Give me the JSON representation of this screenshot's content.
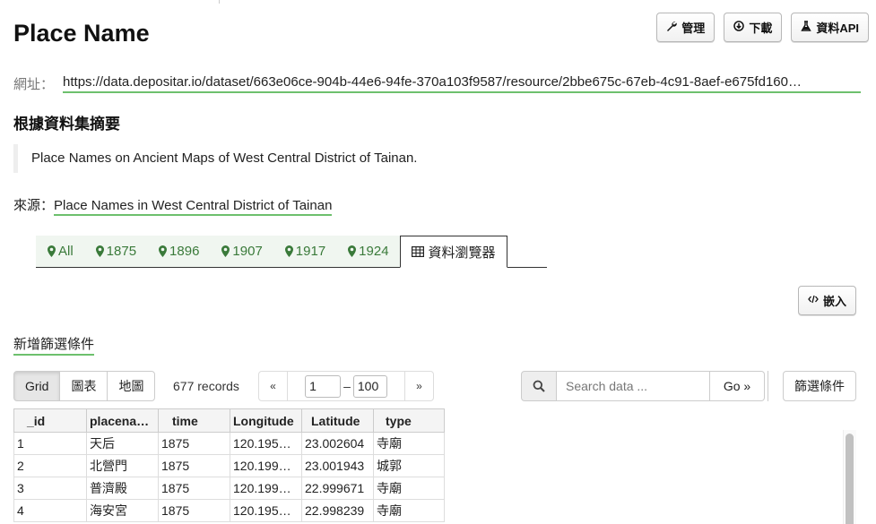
{
  "page": {
    "title": "Place Name"
  },
  "actions": {
    "manage_label": "管理",
    "download_label": "下載",
    "api_label": "資料API"
  },
  "url": {
    "label": "網址：",
    "value": "https://data.depositar.io/dataset/663e06ce-904b-44e6-94fe-370a103f9587/resource/2bbe675c-67eb-4c91-8aef-e675fd160…"
  },
  "summary": {
    "heading": "根據資料集摘要",
    "text": "Place Names on Ancient Maps of West Central District of Tainan."
  },
  "source": {
    "label": "來源：",
    "link_text": "Place Names in West Central District of Tainan"
  },
  "view_tabs": [
    {
      "label": "All",
      "icon": "map-marker-icon"
    },
    {
      "label": "1875",
      "icon": "map-marker-icon"
    },
    {
      "label": "1896",
      "icon": "map-marker-icon"
    },
    {
      "label": "1907",
      "icon": "map-marker-icon"
    },
    {
      "label": "1917",
      "icon": "map-marker-icon"
    },
    {
      "label": "1924",
      "icon": "map-marker-icon"
    },
    {
      "label": "資料瀏覽器",
      "icon": "table-icon",
      "active": true
    }
  ],
  "embed_label": "嵌入",
  "add_filter_label": "新增篩選條件",
  "toolbar": {
    "views": [
      "Grid",
      "圖表",
      "地圖"
    ],
    "records": "677 records",
    "pager": {
      "prev": "«",
      "from": "1",
      "dash": "–",
      "to": "100",
      "next": "»"
    },
    "search_placeholder": "Search data ...",
    "go_label": "Go »",
    "filters_label": "篩選條件"
  },
  "grid": {
    "columns": [
      "_id",
      "placena…",
      "time",
      "Longitude",
      "Latitude",
      "type"
    ],
    "rows": [
      [
        "1",
        "天后",
        "1875",
        "120.195…",
        "23.002604",
        "寺廟"
      ],
      [
        "2",
        "北營門",
        "1875",
        "120.199…",
        "23.001943",
        "城郭"
      ],
      [
        "3",
        "普濟殿",
        "1875",
        "120.199…",
        "22.999671",
        "寺廟"
      ],
      [
        "4",
        "海安宮",
        "1875",
        "120.195…",
        "22.998239",
        "寺廟"
      ]
    ]
  },
  "colors": {
    "link_underline": "#6dc06d",
    "tab_green": "#3a7a3a",
    "tab_bg": "#f0f6f0"
  }
}
